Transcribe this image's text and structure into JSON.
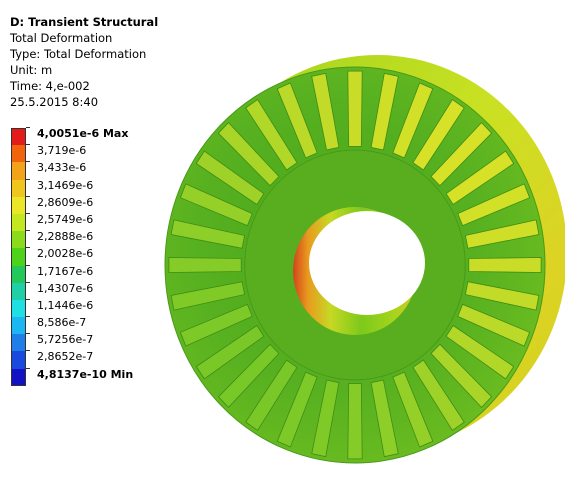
{
  "header": {
    "title": "D: Transient Structural",
    "result": "Total Deformation",
    "type": "Type: Total Deformation",
    "unit": "Unit: m",
    "time": "Time: 4,e-002",
    "date": "25.5.2015 8:40"
  },
  "legend": {
    "entries": [
      {
        "label": "4,0051e-6 Max",
        "color": "#e41b1b",
        "bold": true
      },
      {
        "label": "3,719e-6",
        "color": "#f2640c",
        "bold": false
      },
      {
        "label": "3,433e-6",
        "color": "#f3a319",
        "bold": false
      },
      {
        "label": "3,1469e-6",
        "color": "#f0c61e",
        "bold": false
      },
      {
        "label": "2,8609e-6",
        "color": "#ebe727",
        "bold": false
      },
      {
        "label": "2,5749e-6",
        "color": "#c4e81f",
        "bold": false
      },
      {
        "label": "2,2888e-6",
        "color": "#8bdb1a",
        "bold": false
      },
      {
        "label": "2,0028e-6",
        "color": "#4fd21a",
        "bold": false
      },
      {
        "label": "1,7167e-6",
        "color": "#22c85a",
        "bold": false
      },
      {
        "label": "1,4307e-6",
        "color": "#1fcfa5",
        "bold": false
      },
      {
        "label": "1,1446e-6",
        "color": "#1ee0e3",
        "bold": false
      },
      {
        "label": "8,586e-7",
        "color": "#1bb7f3",
        "bold": false
      },
      {
        "label": "5,7256e-7",
        "color": "#1f7ee8",
        "bold": false
      },
      {
        "label": "2,8652e-7",
        "color": "#1a49dd",
        "bold": false
      },
      {
        "label": "4,8137e-10 Min",
        "color": "#1212c4",
        "bold": true
      }
    ]
  },
  "model": {
    "name": "stator deformation contour",
    "tooth_count": 32
  }
}
